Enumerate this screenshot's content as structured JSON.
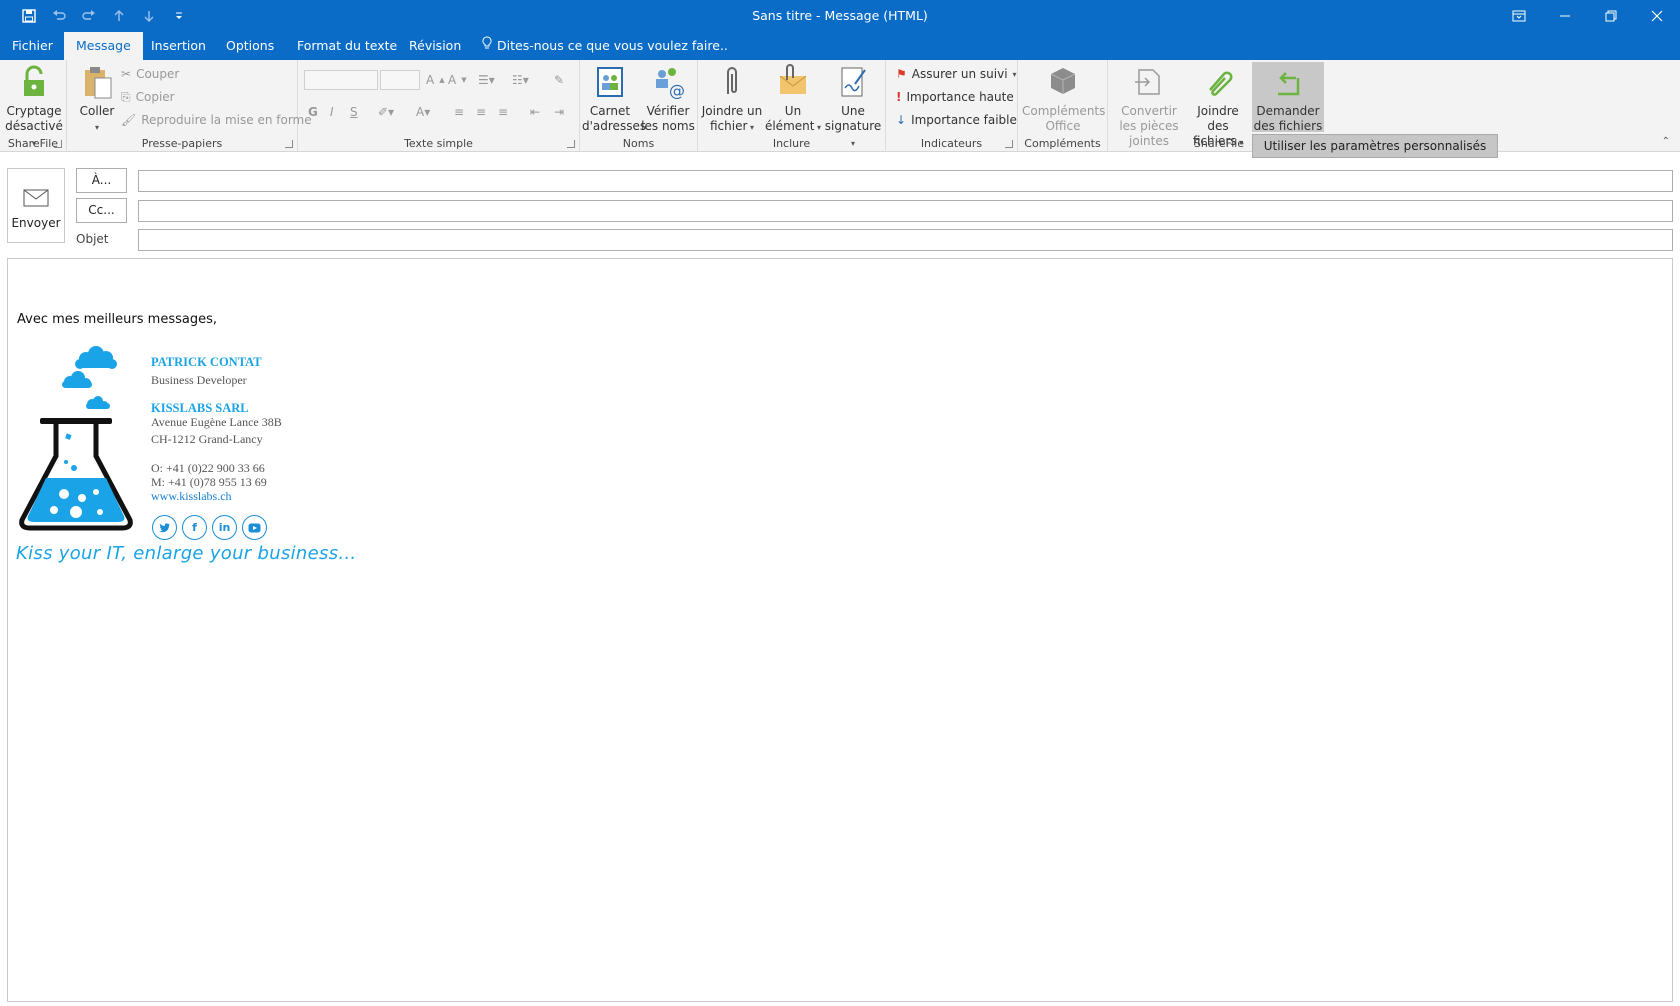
{
  "window": {
    "title": "Sans titre  -  Message (HTML)"
  },
  "tabs": [
    {
      "label": "Fichier"
    },
    {
      "label": "Message"
    },
    {
      "label": "Insertion"
    },
    {
      "label": "Options"
    },
    {
      "label": "Format du texte"
    },
    {
      "label": "Révision"
    }
  ],
  "tellme": "Dites-nous ce que vous voulez faire..",
  "ribbon": {
    "sharefile1": {
      "btn": "Cryptage désactivé",
      "label": "ShareFile"
    },
    "clipboard": {
      "paste": "Coller",
      "cut": "Couper",
      "copy": "Copier",
      "format_painter": "Reproduire la mise en forme",
      "label": "Presse-papiers"
    },
    "basictext": {
      "label": "Texte simple"
    },
    "names": {
      "address_book": "Carnet d'adresses",
      "check_names": "Vérifier les noms",
      "label": "Noms"
    },
    "include": {
      "attach_file": "Joindre un fichier",
      "attach_item": "Un élément",
      "signature": "Une signature",
      "label": "Inclure"
    },
    "tags": {
      "followup": "Assurer un suivi",
      "high": "Importance haute",
      "low": "Importance faible",
      "label": "Indicateurs"
    },
    "addins": {
      "office": "Compléments Office",
      "label": "Compléments"
    },
    "sharefile2": {
      "convert": "Convertir les pièces jointes",
      "attach": "Joindre des fichiers",
      "request": "Demander des fichiers",
      "label": "ShareFile"
    }
  },
  "dropdown": {
    "item": "Utiliser les paramètres personnalisés"
  },
  "compose": {
    "send": "Envoyer",
    "to": "À...",
    "cc": "Cc...",
    "subject": "Objet",
    "to_value": "",
    "cc_value": "",
    "subject_value": ""
  },
  "body": {
    "greeting": "Avec mes meilleurs messages,",
    "signature": {
      "name": "PATRICK CONTAT",
      "role": "Business Developer",
      "company": "KISSLABS SARL",
      "street": "Avenue Eugène Lance 38B",
      "city": "CH-1212 Grand-Lancy",
      "phone_o": "O: +41 (0)22 900 33 66",
      "phone_m": "M: +41 (0)78 955 13 69",
      "web": "www.kisslabs.ch",
      "slogan": "Kiss your IT, enlarge your business..."
    }
  }
}
